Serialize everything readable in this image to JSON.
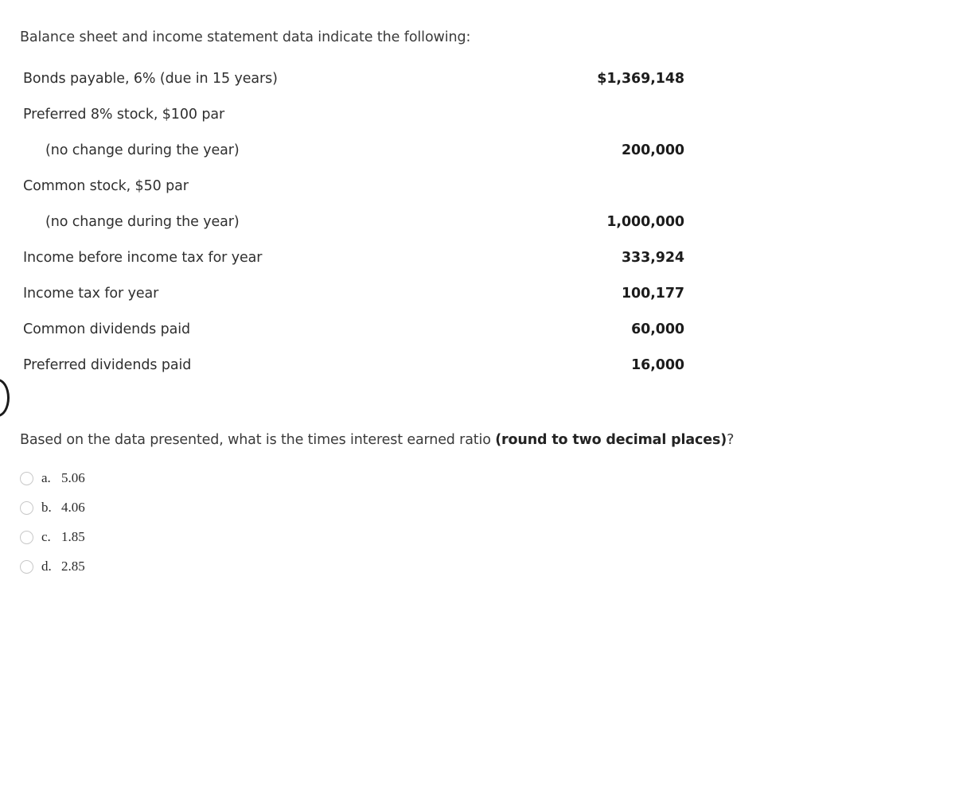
{
  "intro": "Balance sheet and income statement data indicate the following:",
  "table": {
    "rows": [
      {
        "label": "Bonds payable, 6% (due in 15 years)",
        "amount": "$1,369,148",
        "indent": false
      },
      {
        "label": "Preferred 8% stock, $100 par",
        "amount": "",
        "indent": false
      },
      {
        "label": "(no change during the year)",
        "amount": "200,000",
        "indent": true
      },
      {
        "label": "Common stock, $50 par",
        "amount": "",
        "indent": false
      },
      {
        "label": "(no change during the year)",
        "amount": "1,000,000",
        "indent": true
      },
      {
        "label": "Income before income tax for year",
        "amount": "333,924",
        "indent": false
      },
      {
        "label": "Income tax for year",
        "amount": "100,177",
        "indent": false
      },
      {
        "label": "Common dividends paid",
        "amount": "60,000",
        "indent": false
      },
      {
        "label": "Preferred dividends paid",
        "amount": "16,000",
        "indent": false
      }
    ]
  },
  "question": {
    "text_before": "Based on the data presented, what is the times interest earned ratio ",
    "emphasis": "(round to two decimal places)",
    "text_after": "?"
  },
  "options": [
    {
      "letter": "a.",
      "value": "5.06"
    },
    {
      "letter": "b.",
      "value": "4.06"
    },
    {
      "letter": "c.",
      "value": "1.85"
    },
    {
      "letter": "d.",
      "value": "2.85"
    }
  ],
  "colors": {
    "text": "#3a3a3a",
    "amount": "#1c1c1c",
    "radio_border": "#c8c8c8",
    "background": "#ffffff"
  }
}
